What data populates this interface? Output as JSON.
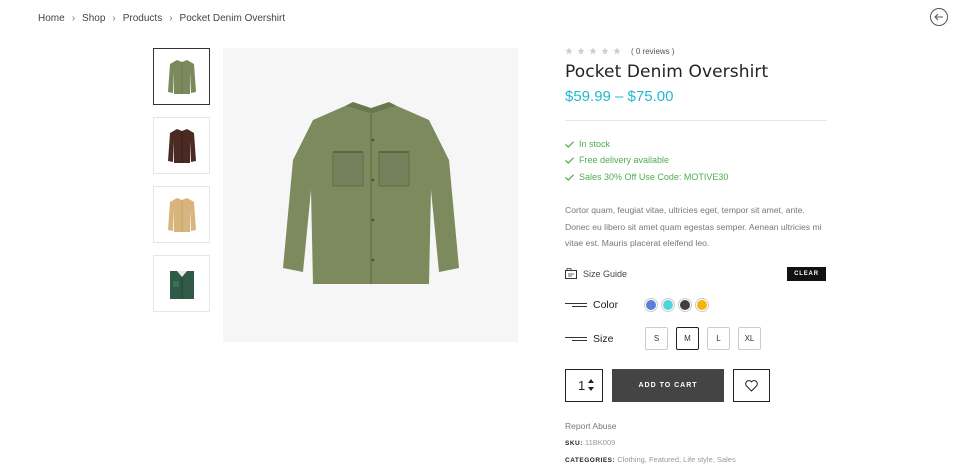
{
  "breadcrumb": {
    "items": [
      "Home",
      "Shop",
      "Products",
      "Pocket Denim Overshirt"
    ],
    "separator": ">"
  },
  "back_button_icon": "arrow-left-circle-icon",
  "product": {
    "reviews": "( 0 reviews )",
    "rating": 0,
    "title": "Pocket Denim Overshirt",
    "price": "$59.99 – $75.00",
    "features": [
      "In stock",
      "Free delivery available",
      "Sales 30% Off Use Code: MOTIVE30"
    ],
    "description": "Cortor quam, feugiat vitae, ultricies eget, tempor sit amet, ante. Donec eu libero sit amet quam egestas semper. Aenean ultricies mi vitae est. Mauris placerat eleifend leo.",
    "size_guide": "Size Guide",
    "clear": "CLEAR",
    "color_label": "Color",
    "colors": [
      "#5b7ed8",
      "#4fd4dc",
      "#3f3f3f",
      "#f2b705"
    ],
    "size_label": "Size",
    "sizes": [
      "S",
      "M",
      "L",
      "XL"
    ],
    "selected_size": "M",
    "quantity": "1",
    "add_to_cart": "ADD TO CART",
    "report": "Report Abuse",
    "sku_label": "SKU:",
    "sku": "11BK009",
    "categories_label": "CATEGORIES:",
    "categories": [
      "Clothing",
      "Featured",
      "Life style",
      "Sales"
    ]
  },
  "thumbnails": [
    "olive-shirt",
    "brown-shirt",
    "tan-shirt",
    "green-folded-shirt"
  ],
  "colors": {
    "accent_price": "#22b8cf",
    "feature_green": "#4caf50",
    "cart_button": "#444444"
  }
}
